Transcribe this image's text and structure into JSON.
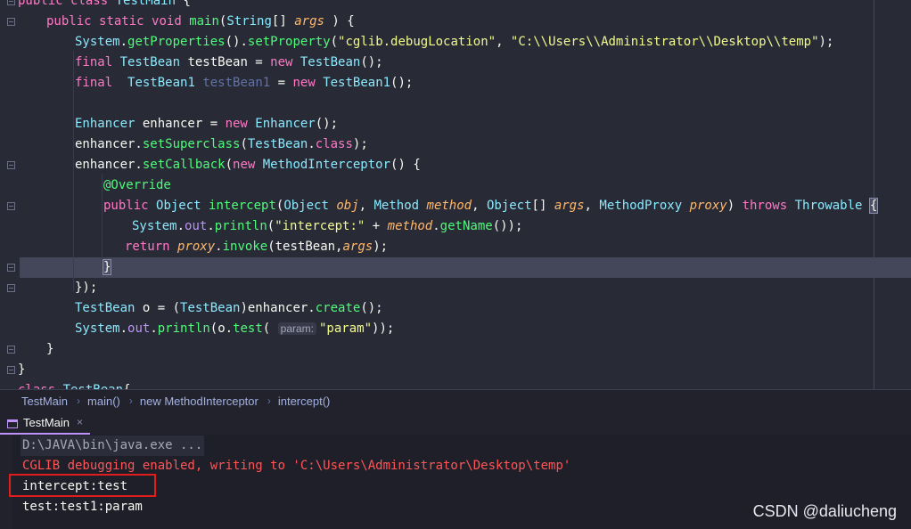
{
  "editor": {
    "lines": [
      {
        "parts": [
          [
            "kw",
            "public "
          ],
          [
            "kw",
            "class "
          ],
          [
            "cls",
            "TestMain "
          ],
          [
            "",
            "{"
          ]
        ]
      },
      {
        "parts": [
          [
            "kw",
            "public "
          ],
          [
            "kw",
            "static "
          ],
          [
            "kw",
            "void "
          ],
          [
            "fn",
            "main"
          ],
          [
            "",
            "("
          ],
          [
            "cls",
            "String"
          ],
          [
            "",
            "[] "
          ],
          [
            "param",
            "args"
          ],
          [
            "",
            " ) {"
          ]
        ]
      },
      {
        "parts": [
          [
            "cls",
            "System"
          ],
          [
            "",
            "."
          ],
          [
            "fn",
            "getProperties"
          ],
          [
            "",
            "()."
          ],
          [
            "fn",
            "setProperty"
          ],
          [
            "",
            "("
          ],
          [
            "str",
            "\"cglib.debugLocation\""
          ],
          [
            "",
            ", "
          ],
          [
            "str",
            "\"C:\\\\Users\\\\Administrator\\\\Desktop\\\\temp\""
          ],
          [
            "",
            ");"
          ]
        ]
      },
      {
        "parts": [
          [
            "kw",
            "final "
          ],
          [
            "cls",
            "TestBean "
          ],
          [
            "",
            "testBean = "
          ],
          [
            "kw",
            "new "
          ],
          [
            "cls",
            "TestBean"
          ],
          [
            "",
            "();"
          ]
        ]
      },
      {
        "parts": [
          [
            "kw",
            "final  "
          ],
          [
            "cls",
            "TestBean1 "
          ],
          [
            "grey",
            "testBean1"
          ],
          [
            "",
            " = "
          ],
          [
            "kw",
            "new "
          ],
          [
            "cls",
            "TestBean1"
          ],
          [
            "",
            "();"
          ]
        ]
      },
      {
        "parts": []
      },
      {
        "parts": [
          [
            "cls",
            "Enhancer "
          ],
          [
            "",
            "enhancer = "
          ],
          [
            "kw",
            "new "
          ],
          [
            "cls",
            "Enhancer"
          ],
          [
            "",
            "();"
          ]
        ]
      },
      {
        "parts": [
          [
            "",
            "enhancer."
          ],
          [
            "fn",
            "setSuperclass"
          ],
          [
            "",
            "("
          ],
          [
            "cls",
            "TestBean"
          ],
          [
            "",
            "."
          ],
          [
            "kw",
            "class"
          ],
          [
            "",
            ");"
          ]
        ]
      },
      {
        "parts": [
          [
            "",
            "enhancer."
          ],
          [
            "fn",
            "setCallback"
          ],
          [
            "",
            "("
          ],
          [
            "kw",
            "new "
          ],
          [
            "cls",
            "MethodInterceptor"
          ],
          [
            "",
            "() {"
          ]
        ]
      },
      {
        "parts": [
          [
            "ann",
            "@Override"
          ]
        ]
      },
      {
        "parts": [
          [
            "kw",
            "public "
          ],
          [
            "cls",
            "Object "
          ],
          [
            "fn",
            "intercept"
          ],
          [
            "",
            "("
          ],
          [
            "cls",
            "Object "
          ],
          [
            "param",
            "obj"
          ],
          [
            "",
            ", "
          ],
          [
            "cls",
            "Method "
          ],
          [
            "param",
            "method"
          ],
          [
            "",
            ", "
          ],
          [
            "cls",
            "Object"
          ],
          [
            "",
            "[] "
          ],
          [
            "param",
            "args"
          ],
          [
            "",
            ", "
          ],
          [
            "cls",
            "MethodProxy "
          ],
          [
            "param",
            "proxy"
          ],
          [
            "",
            ") "
          ],
          [
            "kw",
            "throws "
          ],
          [
            "cls",
            "Throwable "
          ],
          [
            "brace",
            "{"
          ]
        ]
      },
      {
        "parts": [
          [
            "cls",
            "System"
          ],
          [
            "",
            "."
          ],
          [
            "field",
            "out"
          ],
          [
            "",
            "."
          ],
          [
            "fn",
            "println"
          ],
          [
            "",
            "("
          ],
          [
            "str",
            "\"intercept:\""
          ],
          [
            "",
            " + "
          ],
          [
            "param",
            "method"
          ],
          [
            "",
            "."
          ],
          [
            "fn",
            "getName"
          ],
          [
            "",
            "());"
          ]
        ]
      },
      {
        "parts": [
          [
            "kw",
            "return "
          ],
          [
            "param",
            "proxy"
          ],
          [
            "",
            "."
          ],
          [
            "fn",
            "invoke"
          ],
          [
            "",
            "(testBean,"
          ],
          [
            "param",
            "args"
          ],
          [
            "",
            ");"
          ]
        ]
      },
      {
        "parts": [
          [
            "brace",
            "}"
          ]
        ]
      },
      {
        "parts": [
          [
            "",
            "});"
          ]
        ]
      },
      {
        "parts": [
          [
            "cls",
            "TestBean "
          ],
          [
            "",
            "o = ("
          ],
          [
            "cls",
            "TestBean"
          ],
          [
            "",
            ")enhancer."
          ],
          [
            "fn",
            "create"
          ],
          [
            "",
            "();"
          ]
        ]
      },
      {
        "parts": [
          [
            "cls",
            "System"
          ],
          [
            "",
            "."
          ],
          [
            "field",
            "out"
          ],
          [
            "",
            "."
          ],
          [
            "fn",
            "println"
          ],
          [
            "",
            "(o."
          ],
          [
            "fn",
            "test"
          ],
          [
            "",
            "( "
          ],
          [
            "hint",
            "param:"
          ],
          [
            "str",
            "\"param\""
          ],
          [
            "",
            "));"
          ]
        ]
      },
      {
        "parts": [
          [
            "",
            "}"
          ]
        ]
      },
      {
        "parts": [
          [
            "",
            "}"
          ]
        ]
      },
      {
        "parts": [
          [
            "kw",
            "class "
          ],
          [
            "cls",
            "TestBean"
          ],
          [
            "",
            "{"
          ]
        ]
      }
    ]
  },
  "breadcrumb": {
    "items": [
      "TestMain",
      "main()",
      "new MethodInterceptor",
      "intercept()"
    ]
  },
  "run_tab": {
    "label": "TestMain",
    "close": "×"
  },
  "console": {
    "cmd": "D:\\JAVA\\bin\\java.exe ...",
    "debug": "CGLIB debugging enabled, writing to 'C:\\Users\\Administrator\\Desktop\\temp'",
    "out1": "intercept:test",
    "out2": "test:test1:param"
  },
  "watermark": "CSDN @daliucheng",
  "colors": {
    "background": "#282a36",
    "keyword": "#ff79c6",
    "class": "#8be9fd",
    "function": "#50fa7b",
    "string": "#f1fa8c",
    "error_text": "#ff5555",
    "annotation_box": "#e01c1c"
  }
}
